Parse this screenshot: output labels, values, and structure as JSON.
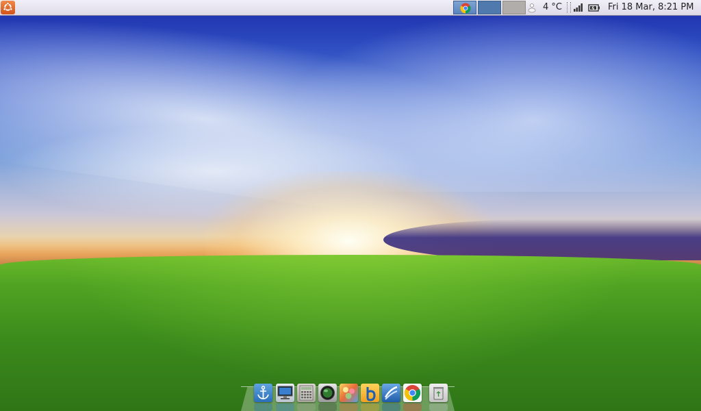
{
  "top_panel": {
    "clock": "Fri 18 Mar,  8:21 PM",
    "temperature": "4 °C",
    "taskbar": [
      {
        "name": "chrome-icon"
      }
    ],
    "workspaces": [
      {
        "state": "active",
        "color": "#5079ad"
      },
      {
        "state": "inactive",
        "color": "#b1adaa"
      }
    ],
    "tray_icons": [
      "weather-icon",
      "signal-icon",
      "battery-icon"
    ]
  },
  "dock": {
    "items": [
      {
        "name": "anchor-icon"
      },
      {
        "name": "monitor-icon"
      },
      {
        "name": "calculator-icon"
      },
      {
        "name": "globe-icon"
      },
      {
        "name": "image-viewer-icon"
      },
      {
        "name": "bluefish-icon"
      },
      {
        "name": "document-icon"
      },
      {
        "name": "chrome-icon"
      },
      {
        "name": "trash-icon"
      }
    ]
  },
  "colors": {
    "panel": "#e6e3ee",
    "ubuntu_orange": "#dd5a1f",
    "sky": "#2f4fc2",
    "grass": "#4fa322"
  }
}
